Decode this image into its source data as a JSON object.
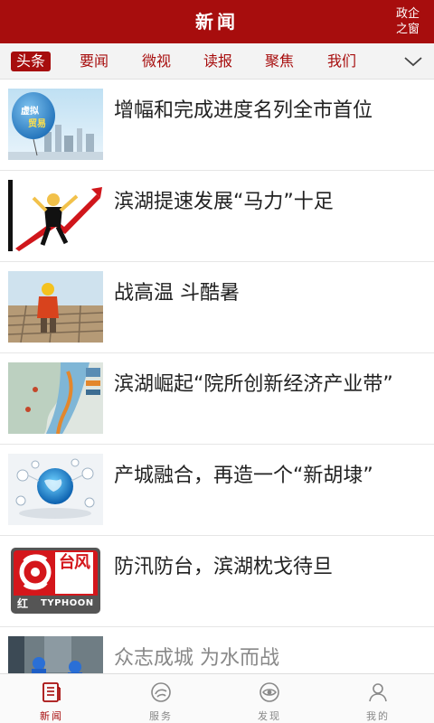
{
  "header": {
    "title": "新闻",
    "corner_line1": "政企",
    "corner_line2": "之窗"
  },
  "tabs": {
    "items": [
      {
        "label": "头条",
        "active": true
      },
      {
        "label": "要闻",
        "active": false
      },
      {
        "label": "微视",
        "active": false
      },
      {
        "label": "读报",
        "active": false
      },
      {
        "label": "聚焦",
        "active": false
      },
      {
        "label": "我们",
        "active": false
      }
    ],
    "more_icon": "chevron-down-icon"
  },
  "news": {
    "items": [
      {
        "headline": "增幅和完成进度名列全市首位",
        "thumb_text": "虚拟\n贸易",
        "thumb_icon": "balloon-city-image"
      },
      {
        "headline": "滨湖提速发展“马力”十足",
        "thumb_icon": "rising-arrow-man-image"
      },
      {
        "headline": "战高温 斗酷暑",
        "thumb_icon": "construction-worker-image"
      },
      {
        "headline": "滨湖崛起“院所创新经济产业带”",
        "thumb_icon": "map-image"
      },
      {
        "headline": "产城融合，再造一个“新胡埭”",
        "thumb_icon": "globe-network-image"
      },
      {
        "headline": "防汛防台，滨湖枕戈待旦",
        "thumb_badge_top": "台风",
        "thumb_badge_left": "红",
        "thumb_badge_bottom": "TYPHOON",
        "thumb_icon": "typhoon-warning-image"
      },
      {
        "headline": "众志成城 为水而战",
        "thumb_icon": "flood-workers-image"
      }
    ]
  },
  "tabbar": {
    "items": [
      {
        "label": "新闻",
        "icon": "newspaper-icon",
        "active": true
      },
      {
        "label": "服务",
        "icon": "service-icon",
        "active": false
      },
      {
        "label": "发现",
        "icon": "discover-icon",
        "active": false
      },
      {
        "label": "我的",
        "icon": "person-icon",
        "active": false
      }
    ]
  },
  "colors": {
    "brand": "#a70d0d",
    "text": "#222222",
    "muted": "#888888"
  }
}
